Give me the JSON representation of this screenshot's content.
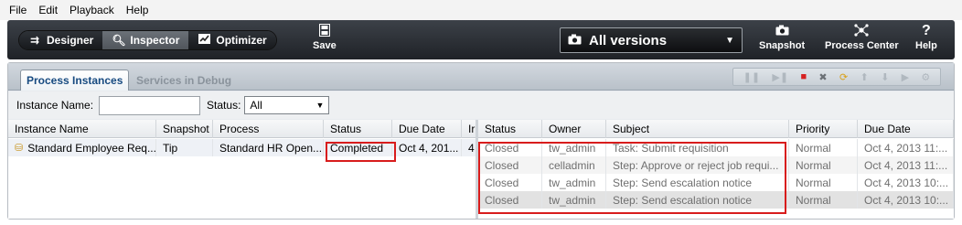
{
  "menu": [
    "File",
    "Edit",
    "Playback",
    "Help"
  ],
  "modes": [
    {
      "label": "Designer",
      "icon": "designer-icon",
      "active": false
    },
    {
      "label": "Inspector",
      "icon": "magnifier-icon",
      "active": true
    },
    {
      "label": "Optimizer",
      "icon": "chart-icon",
      "active": false
    }
  ],
  "toolbar": {
    "save_label": "Save",
    "version_selector": "All versions",
    "snapshot_label": "Snapshot",
    "process_center_label": "Process Center",
    "help_label": "Help"
  },
  "tabs": [
    {
      "label": "Process Instances",
      "active": true
    },
    {
      "label": "Services in Debug",
      "active": false
    }
  ],
  "filters": {
    "instance_name_label": "Instance Name:",
    "instance_name_value": "",
    "status_label": "Status:",
    "status_value": "All"
  },
  "instances_table": {
    "columns": [
      "Instance Name",
      "Snapshot",
      "Process",
      "Status",
      "Due Date",
      "Ir"
    ],
    "rows": [
      {
        "instance_name": "Standard Employee Req...",
        "snapshot": "Tip",
        "process": "Standard HR Open...",
        "status": "Completed",
        "due_date": "Oct 4, 201...",
        "extra": "4"
      }
    ]
  },
  "tasks_table": {
    "columns": [
      "Status",
      "Owner",
      "Subject",
      "Priority",
      "Due Date"
    ],
    "rows": [
      {
        "status": "Closed",
        "owner": "tw_admin",
        "subject": "Task: Submit requisition",
        "priority": "Normal",
        "due_date": "Oct 4, 2013 11:..."
      },
      {
        "status": "Closed",
        "owner": "celladmin",
        "subject": "Step:  Approve or reject job requi...",
        "priority": "Normal",
        "due_date": "Oct 4, 2013 11:..."
      },
      {
        "status": "Closed",
        "owner": "tw_admin",
        "subject": "Step: Send escalation notice",
        "priority": "Normal",
        "due_date": "Oct 4, 2013 10:..."
      },
      {
        "status": "Closed",
        "owner": "tw_admin",
        "subject": "Step: Send escalation notice",
        "priority": "Normal",
        "due_date": "Oct 4, 2013 10:..."
      }
    ]
  },
  "colors": {
    "highlight": "#d81c1c",
    "accent": "#174a80"
  }
}
